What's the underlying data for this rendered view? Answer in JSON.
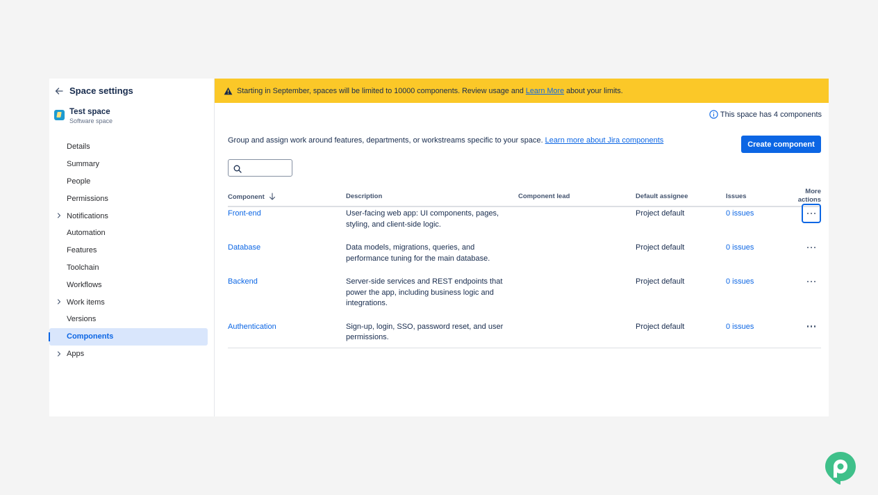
{
  "sidebar": {
    "title": "Space settings",
    "space_name": "Test space",
    "space_type": "Software space",
    "items": [
      {
        "label": "Details",
        "expandable": false
      },
      {
        "label": "Summary",
        "expandable": false
      },
      {
        "label": "People",
        "expandable": false
      },
      {
        "label": "Permissions",
        "expandable": false
      },
      {
        "label": "Notifications",
        "expandable": true
      },
      {
        "label": "Automation",
        "expandable": false
      },
      {
        "label": "Features",
        "expandable": false
      },
      {
        "label": "Toolchain",
        "expandable": false
      },
      {
        "label": "Workflows",
        "expandable": false
      },
      {
        "label": "Work items",
        "expandable": true
      },
      {
        "label": "Versions",
        "expandable": false
      },
      {
        "label": "Components",
        "expandable": false,
        "active": true
      },
      {
        "label": "Apps",
        "expandable": true
      }
    ]
  },
  "banner": {
    "text_before": "Starting in September, spaces will be limited to 10000 components. Review usage and",
    "link": "Learn More",
    "text_after": "about your limits."
  },
  "count_note": "This space has 4 components",
  "intro": {
    "text": "Group and assign work around features, departments, or workstreams specific to your space.",
    "link": "Learn more about Jira components"
  },
  "create_button": "Create component",
  "search": {
    "value": "",
    "placeholder": ""
  },
  "table": {
    "headers": {
      "component": "Component",
      "description": "Description",
      "lead": "Component lead",
      "assignee": "Default assignee",
      "issues": "Issues",
      "more_line1": "More",
      "more_line2": "actions"
    },
    "rows": [
      {
        "name": "Front-end",
        "desc": [
          "User-facing web app: UI components, pages,",
          "styling, and client-side logic."
        ],
        "lead": "",
        "assignee": "Project default",
        "issues": "0 issues"
      },
      {
        "name": "Database",
        "desc": [
          "Data models, migrations, queries, and",
          "performance tuning for the main database."
        ],
        "lead": "",
        "assignee": "Project default",
        "issues": "0 issues"
      },
      {
        "name": "Backend",
        "desc": [
          "Server-side services and REST endpoints that",
          "power the app, including business logic and",
          "integrations."
        ],
        "lead": "",
        "assignee": "Project default",
        "issues": "0 issues"
      },
      {
        "name": "Authentication",
        "desc": [
          "Sign-up, login, SSO, password reset, and user",
          "permissions."
        ],
        "lead": "",
        "assignee": "Project default",
        "issues": "0 issues"
      }
    ]
  },
  "colors": {
    "accent": "#0c66e4",
    "banner": "#fbc828",
    "active_nav_bg": "#d9e6fc",
    "logo": "#3fc08a"
  },
  "icons": {
    "back": "arrow-left-icon",
    "warning": "warning-triangle-icon",
    "info": "info-circle-icon",
    "search": "search-icon",
    "sort": "arrow-down-icon",
    "more": "more-dots-icon",
    "chevron": "chevron-right-icon"
  }
}
